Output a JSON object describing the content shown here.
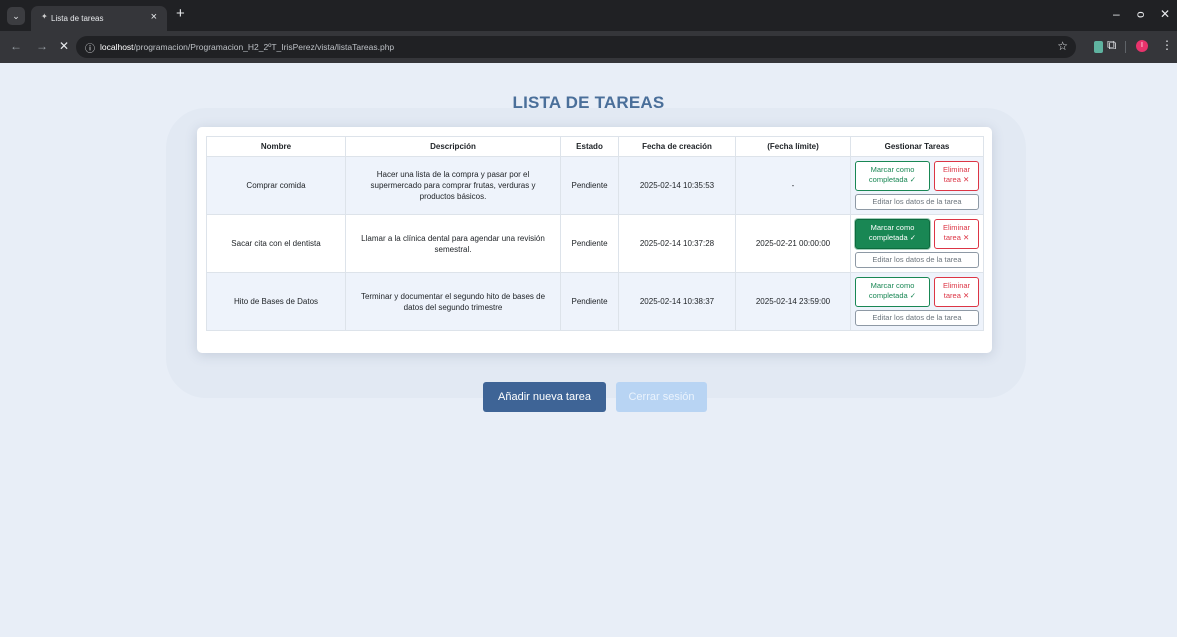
{
  "browser": {
    "tab_list_icon": "chevron-down-icon",
    "tab": {
      "title": "Lista de tareas",
      "favicon": "sparkle-icon",
      "close_glyph": "×"
    },
    "new_tab_glyph": "+",
    "window_controls": {
      "minimize": "–",
      "restore": "ᴑ",
      "close": "✕"
    },
    "nav": {
      "back": "←",
      "forward": "→",
      "stop": "✕"
    },
    "url_host": "localhost",
    "url_path": "/programacion/Programacion_H2_2ºT_IrisPerez/vista/listaTareas.php",
    "bookmark_glyph": "☆",
    "profile_initial": "I",
    "menu_glyph": "⋮",
    "extensions_glyph": "⧉"
  },
  "page": {
    "title": "LISTA DE TAREAS",
    "add_button": "Añadir nueva tarea",
    "logout_button": "Cerrar sesión"
  },
  "table": {
    "headers": [
      "Nombre",
      "Descripción",
      "Estado",
      "Fecha de creación",
      "(Fecha límite)",
      "Gestionar Tareas"
    ],
    "rows": [
      {
        "nombre": "Comprar comida",
        "descripcion": "Hacer una lista de la compra y pasar por el supermercado para comprar frutas, verduras y productos básicos.",
        "estado": "Pendiente",
        "creacion": "2025-02-14 10:35:53",
        "limite": "-"
      },
      {
        "nombre": "Sacar cita con el dentista",
        "descripcion": "Llamar a la clínica dental para agendar una revisión semestral.",
        "estado": "Pendiente",
        "creacion": "2025-02-14 10:37:28",
        "limite": "2025-02-21 00:00:00"
      },
      {
        "nombre": "Hito de Bases de Datos",
        "descripcion": "Terminar y documentar el segundo hito de bases de datos del segundo trimestre",
        "estado": "Pendiente",
        "creacion": "2025-02-14 10:38:37",
        "limite": "2025-02-14 23:59:00"
      }
    ],
    "actions": {
      "complete": "Marcar como completada ✓",
      "delete": "Eliminar tarea ✕",
      "edit": "Editar los datos de la tarea"
    }
  }
}
